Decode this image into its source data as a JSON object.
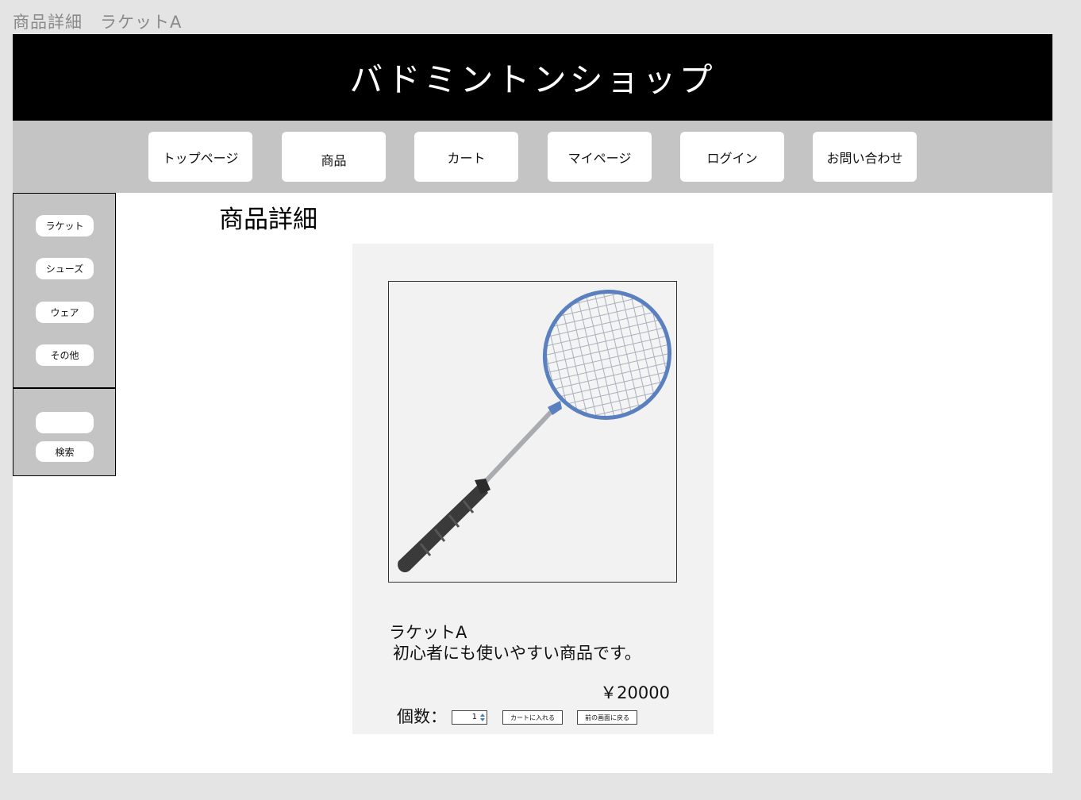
{
  "page_label": "商品詳細　ラケットA",
  "header": {
    "title": "バドミントンショップ"
  },
  "nav": {
    "items": [
      "トップページ",
      "商品",
      "カート",
      "マイページ",
      "ログイン",
      "お問い合わせ"
    ]
  },
  "sidebar": {
    "categories": [
      "ラケット",
      "シューズ",
      "ウェア",
      "その他"
    ],
    "search_value": "",
    "search_button": "検索"
  },
  "main": {
    "section_title": "商品詳細",
    "product": {
      "name": "ラケットA",
      "description": "初心者にも使いやすい商品です。",
      "price": "￥20000",
      "image_icon": "badminton-racket-icon"
    },
    "quantity_label": "個数：",
    "quantity_value": "1",
    "add_to_cart_label": "カートに入れる",
    "back_label": "前の画面に戻る"
  },
  "colors": {
    "background": "#e4e4e4",
    "header": "#000000",
    "nav": "#c4c4c4",
    "card": "#f2f2f2",
    "racket_head": "#5b80c0",
    "grip": "#3a3a3a"
  }
}
